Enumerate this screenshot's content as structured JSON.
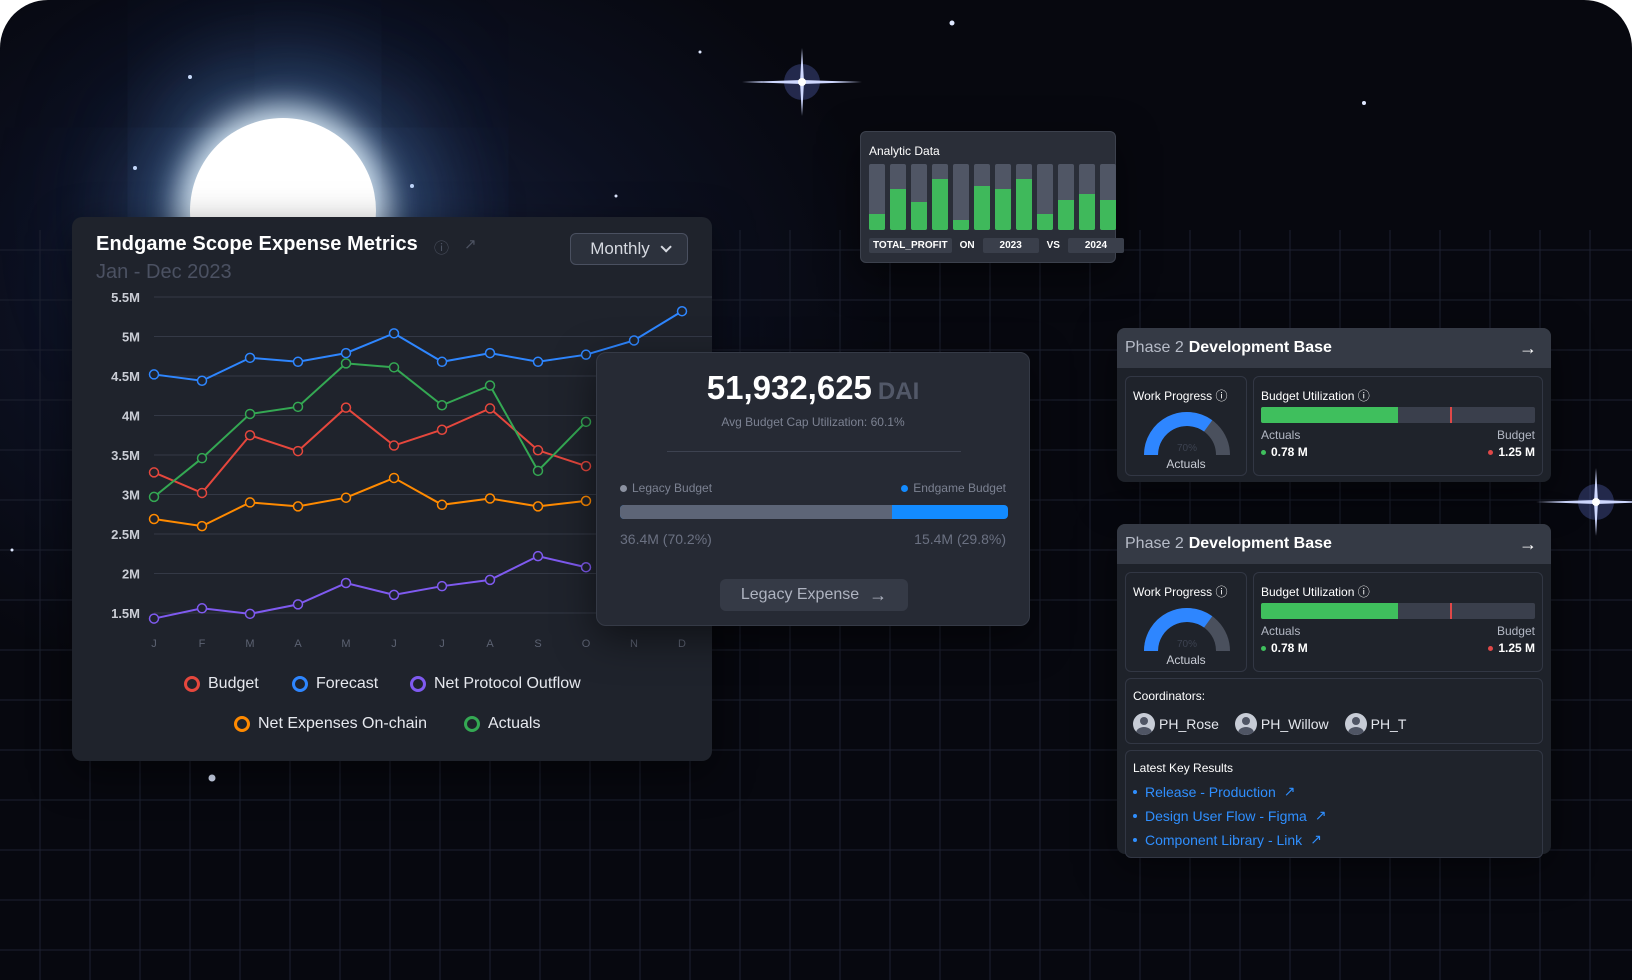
{
  "main_card": {
    "title": "Endgame Scope Expense Metrics",
    "subtitle": "Jan - Dec 2023",
    "info_icon": "info-icon",
    "external_icon": "external-link-icon",
    "period_select": "Monthly"
  },
  "chart_data": {
    "type": "line",
    "categories": [
      "J",
      "F",
      "M",
      "A",
      "M",
      "J",
      "J",
      "A",
      "S",
      "O",
      "N",
      "D"
    ],
    "y_ticks": [
      "5.5M",
      "5M",
      "4.5M",
      "4M",
      "3.5M",
      "3M",
      "2.5M",
      "2M",
      "1.5M"
    ],
    "ylim": [
      1.45,
      5.5
    ],
    "grid": true,
    "legend": "bottom",
    "series": [
      {
        "name": "Budget",
        "color": "#e5473d",
        "values": [
          3.28,
          3.02,
          3.75,
          3.55,
          4.1,
          3.62,
          3.82,
          4.09,
          3.56,
          3.36,
          null,
          null
        ]
      },
      {
        "name": "Forecast",
        "color": "#2e86ff",
        "values": [
          4.52,
          4.44,
          4.73,
          4.68,
          4.79,
          5.04,
          4.68,
          4.79,
          4.68,
          4.77,
          4.95,
          5.32
        ]
      },
      {
        "name": "Net Protocol Outflow",
        "color": "#7f5af0",
        "values": [
          1.43,
          1.56,
          1.49,
          1.61,
          1.88,
          1.73,
          1.84,
          1.92,
          2.22,
          2.08,
          null,
          null
        ]
      },
      {
        "name": "Net Expenses On-chain",
        "color": "#ff8a00",
        "values": [
          2.69,
          2.6,
          2.9,
          2.85,
          2.96,
          3.21,
          2.87,
          2.95,
          2.85,
          2.92,
          null,
          null
        ]
      },
      {
        "name": "Actuals",
        "color": "#34a853",
        "values": [
          2.97,
          3.46,
          4.02,
          4.11,
          4.66,
          4.61,
          4.13,
          4.38,
          3.3,
          3.92,
          null,
          null
        ]
      }
    ]
  },
  "budget_popup": {
    "total": "51,932,625",
    "unit": "DAI",
    "avg_label": "Avg Budget Cap Utilization:",
    "avg_value": "60.1%",
    "legacy_label": "Legacy Budget",
    "endgame_label": "Endgame Budget",
    "legacy_share": 0.702,
    "legacy_value": "36.4M (70.2%)",
    "endgame_value": "15.4M (29.8%)",
    "button": "Legacy Expense",
    "colors": {
      "legacy": "#5d6577",
      "endgame": "#138bff"
    }
  },
  "analytic": {
    "title": "Analytic Data",
    "bars": [
      0.25,
      0.62,
      0.42,
      0.78,
      0.15,
      0.66,
      0.62,
      0.78,
      0.25,
      0.46,
      0.54,
      0.46
    ],
    "metric": "TOTAL_PROFIT",
    "on": "ON",
    "year_a": "2023",
    "vs": "VS",
    "year_b": "2024"
  },
  "phase_cards": [
    {
      "title_prefix": "Phase 2",
      "title_main": "Development Base",
      "work_progress": "Work Progress",
      "progress": 0.7,
      "progress_label": "70%",
      "actuals_caption": "Actuals",
      "budget_util": "Budget Utilization",
      "util_fill": 0.5,
      "util_marker": 0.69,
      "actuals_label": "Actuals",
      "budget_label": "Budget",
      "actuals_value": "0.78 M",
      "budget_value": "1.25 M"
    },
    {
      "title_prefix": "Phase 2",
      "title_main": "Development Base",
      "work_progress": "Work Progress",
      "progress": 0.7,
      "progress_label": "70%",
      "actuals_caption": "Actuals",
      "budget_util": "Budget Utilization",
      "util_fill": 0.5,
      "util_marker": 0.69,
      "actuals_label": "Actuals",
      "budget_label": "Budget",
      "actuals_value": "0.78 M",
      "budget_value": "1.25 M",
      "coordinators_label": "Coordinators:",
      "coordinators": [
        "PH_Rose",
        "PH_Willow",
        "PH_T"
      ],
      "key_results_label": "Latest Key Results",
      "key_results": [
        "Release - Production",
        "Design User Flow - Figma",
        "Component Library - Link"
      ]
    }
  ]
}
